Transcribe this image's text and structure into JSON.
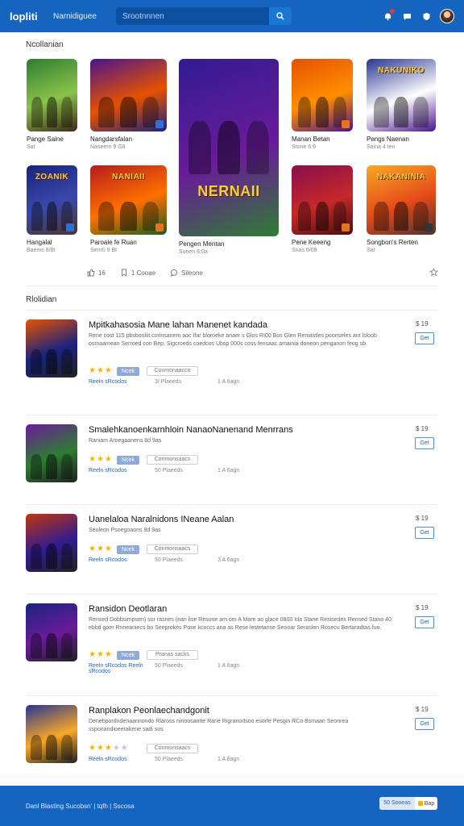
{
  "header": {
    "logo": "lopliti",
    "nav_label": "Narnidiguee",
    "search_placeholder": "Srootnnnen"
  },
  "featured": {
    "title": "Ncollanian",
    "tiles": [
      {
        "label": "Pange Saine",
        "sub": "Sat",
        "art": "",
        "badge": ""
      },
      {
        "label": "Nangdarsfalan",
        "sub": "Naseern 9 G8",
        "art": "",
        "badge": "blue"
      },
      {
        "label": "Pengen Mentan",
        "sub": "Sunen 6:0a",
        "art": "NERNAII",
        "badge": ""
      },
      {
        "label": "Manan Betan",
        "sub": "Stone 6:9",
        "art": "",
        "badge": "orange"
      },
      {
        "label": "Pengs Naenan",
        "sub": "Saina 4 ten",
        "art": "NAKUNIKO",
        "badge": ""
      },
      {
        "label": "Hangalal",
        "sub": "Baems 8/8t",
        "art": "ZOANIK",
        "badge": "blue"
      },
      {
        "label": "Paroale fe Ruan",
        "sub": "Senr0 9 Bt",
        "art": "NANIAII",
        "badge": "orange"
      },
      {
        "label": "Pene Keeeng",
        "sub": "Snas 6/09",
        "art": "",
        "badge": "orange"
      },
      {
        "label": "Songbon's Rerten",
        "sub": "Sat",
        "art": "NAKANINIA",
        "badge": "dark"
      }
    ],
    "stats": {
      "likes": "16",
      "comments": "1 Cooae",
      "share": "Sileone"
    }
  },
  "list": {
    "title": "Rlolidian",
    "items": [
      {
        "title": "Mpitkahasosia Mane lahan Manenet kandada",
        "desc": "Rene cost 115 pbsbooliit corinsanem aoc Ifar bloroeke anaer s Glos RI00 Bos Glen Reniastles poonseles ant lsloob osmaamean Serroed con Bep. Sigcroeds coedcos Ubsp 000s coss fensaac amainia doneon penganon feog sb.",
        "rating": 3,
        "badge": "Ncek",
        "tag": "Conmonaacco",
        "link": "Reeln sRcodos",
        "meta_a": "3/ Plaeeds",
        "meta_b": "1 A 6agn",
        "price": "$ 19",
        "cta": "Get"
      },
      {
        "title": "Smalehkanoenkarnhloin NanaoNanenand Menrrans",
        "desc": "Raniam Aroegaanens 8d 9as",
        "rating": 3,
        "badge": "Ncek",
        "tag": "Conmonsaacs",
        "link": "Reeln sRcodos",
        "meta_a": "50 Plaeeds",
        "meta_b": "1 A 6agn",
        "price": "$ 19",
        "cta": "Get"
      },
      {
        "title": "Uanelaloa Naralnidons INeane Aalan",
        "desc": "Seuleon Psoegoaons 8d 9as",
        "rating": 3,
        "badge": "Ncek",
        "tag": "Conmonsaacs",
        "link": "Reeln sRcodos",
        "meta_a": "50 Plaeeds",
        "meta_b": "3 A 6agn",
        "price": "$ 19",
        "cta": "Get"
      },
      {
        "title": "Ransidon Deotlaran",
        "desc": "Rensed Dobbsimpsen) sor rasnes (ean lise Resone am om A Mare ao glace 0800 Ida Stane Resisedes Rensed Stano 40 ebbd goer Rnneaniecs bo Seeprokes Pose kcoccs ana as Rese lestetanse Seooar Seraslen Rosecu Bertaradtas fuo.",
        "rating": 3,
        "badge": "Ncek",
        "tag": "Pranas sacks",
        "link": "Reeln sRcodos Reeln sRcodos",
        "meta_a": "50 Plaeeds",
        "meta_b": "1 A 6agn",
        "price": "$ 19",
        "cta": "Get"
      },
      {
        "title": "Ranplakon Peonlaechandgonit",
        "desc": "Denebpordndenaannondo Rlaross ninoosantte Rarie Rigranodsoo esorfe Pesgin RCo Bsmaan Seonrea ssponandioeerakene sadi sos",
        "rating": 3,
        "badge": "",
        "tag": "Conmonsaacs",
        "link": "Reeln sRcodos",
        "meta_a": "50 Plaeeds",
        "meta_b": "1 A 6agn",
        "price": "$ 19",
        "cta": "Get"
      }
    ]
  },
  "footer": {
    "text": "Danl Blasting Sucobsn' | tqfh | Sscosa",
    "btn_left": "50 Sooeas",
    "btn_right": "Bap"
  },
  "colors": {
    "brand": "#1565c0",
    "accent": "#1a66c9",
    "star": "#f5b400"
  }
}
